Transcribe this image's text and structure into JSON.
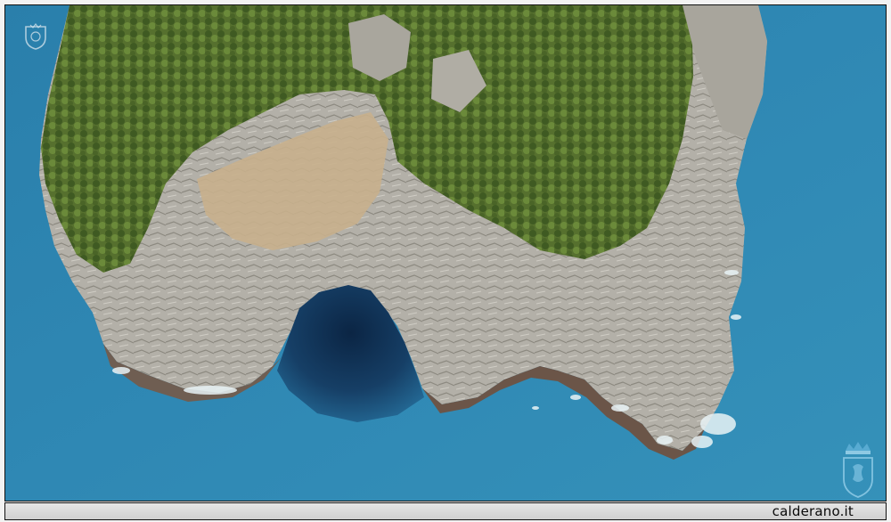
{
  "footer": {
    "site": "calderano.it"
  },
  "icons": {
    "top_left": "crest-watermark-icon",
    "bottom_right": "crowned-shield-watermark-icon"
  },
  "colors": {
    "sea": "#2f86b1",
    "deep_sea": "#1f5f86",
    "cave": "#0f2e4f",
    "rock": "#b7b4ad",
    "vegetation": "#4f6b2a",
    "footer_bg": "#dcdcdc"
  }
}
